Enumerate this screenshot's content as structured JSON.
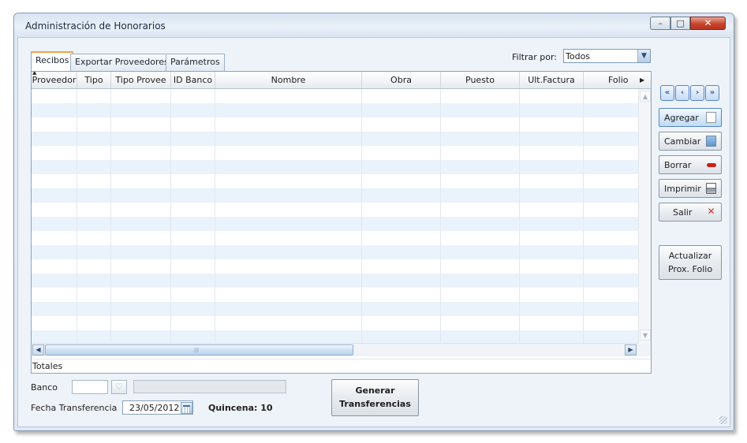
{
  "window": {
    "title": "Administración de Honorarios",
    "controls": {
      "minimize": "–",
      "maximize": "□",
      "close": "✕"
    }
  },
  "tabs": [
    {
      "label": "Recibos",
      "active": true
    },
    {
      "label": "Exportar Proveedores",
      "active": false
    },
    {
      "label": "Parámetros",
      "active": false
    }
  ],
  "filter": {
    "label": "Filtrar por:",
    "value": "Todos"
  },
  "grid": {
    "columns": [
      "Proveedor",
      "Tipo",
      "Tipo Provee",
      "ID Banco",
      "Nombre",
      "Obra",
      "Puesto",
      "Ult.Factura",
      "Folio"
    ],
    "rows": [],
    "totals_label": "Totales",
    "scroll_grip": "|||"
  },
  "navigation": {
    "first": "«",
    "previous": "‹",
    "next": "›",
    "last": "»"
  },
  "actions": {
    "agregar": "Agregar",
    "cambiar": "Cambiar",
    "borrar": "Borrar",
    "imprimir": "Imprimir",
    "salir": "Salir",
    "actualizar_line1": "Actualizar",
    "actualizar_line2": "Prox. Folio"
  },
  "bottom": {
    "banco_label": "Banco",
    "banco_code": "",
    "banco_name": "",
    "fecha_label": "Fecha Transferencia",
    "fecha_value": "23/05/2012",
    "quincena": "Quincena: 10",
    "generar_line1": "Generar",
    "generar_line2": "Transferencias"
  },
  "colors": {
    "row_alt": "#eaf2fb",
    "active_tab_accent": "#f2a447",
    "primary_button": "#4f86c9",
    "borrar_icon": "#d11b1b",
    "salir_icon": "#d0312d"
  }
}
